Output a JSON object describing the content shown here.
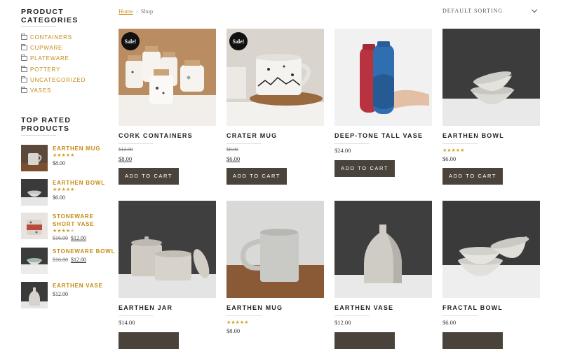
{
  "sidebar": {
    "categories_title": "PRODUCT CATEGORIES",
    "categories": [
      "CONTAINERS",
      "CUPWARE",
      "PLATEWARE",
      "POTTERY",
      "UNCATEGORIZED",
      "VASES"
    ],
    "top_rated_title": "TOP RATED PRODUCTS",
    "top_rated": [
      {
        "name": "EARTHEN MUG",
        "rating": 5,
        "old_price": "",
        "price": "$8.00"
      },
      {
        "name": "EARTHEN BOWL",
        "rating": 5,
        "old_price": "",
        "price": "$6.00"
      },
      {
        "name": "STONEWARE SHORT VASE",
        "rating": 4,
        "old_price": "$16.00",
        "price": "$12.00"
      },
      {
        "name": "STONEWARE BOWL",
        "rating": 0,
        "old_price": "$16.00",
        "price": "$12.00"
      },
      {
        "name": "EARTHEN VASE",
        "rating": 0,
        "old_price": "",
        "price": "$12.00"
      }
    ]
  },
  "breadcrumb": {
    "home": "Home",
    "separator": "›",
    "current": "Shop"
  },
  "sorting": {
    "selected": "DEFAULT SORTING"
  },
  "products": [
    {
      "name": "CORK CONTAINERS",
      "sale_badge": "Sale!",
      "old_price": "$12.00",
      "price": "$8.00",
      "rating": 0,
      "button": "ADD TO CART"
    },
    {
      "name": "CRATER MUG",
      "sale_badge": "Sale!",
      "old_price": "$8.00",
      "price": "$6.00",
      "rating": 0,
      "button": "ADD TO CART"
    },
    {
      "name": "DEEP-TONE TALL VASE",
      "sale_badge": "",
      "old_price": "",
      "price": "$24.00",
      "rating": 0,
      "button": "ADD TO CART"
    },
    {
      "name": "EARTHEN BOWL",
      "sale_badge": "",
      "old_price": "",
      "price": "$6.00",
      "rating": 5,
      "button": "ADD TO CART"
    },
    {
      "name": "EARTHEN JAR",
      "sale_badge": "",
      "old_price": "",
      "price": "$14.00",
      "rating": 0,
      "button": ""
    },
    {
      "name": "EARTHEN MUG",
      "sale_badge": "",
      "old_price": "",
      "price": "$8.00",
      "rating": 5,
      "button": ""
    },
    {
      "name": "EARTHEN VASE",
      "sale_badge": "",
      "old_price": "",
      "price": "$12.00",
      "rating": 0,
      "button": ""
    },
    {
      "name": "FRACTAL BOWL",
      "sale_badge": "",
      "old_price": "",
      "price": "$6.00",
      "rating": 0,
      "button": ""
    }
  ],
  "colors": {
    "accent": "#c58b12",
    "button": "#4a433b",
    "stars": "#c9a227"
  }
}
